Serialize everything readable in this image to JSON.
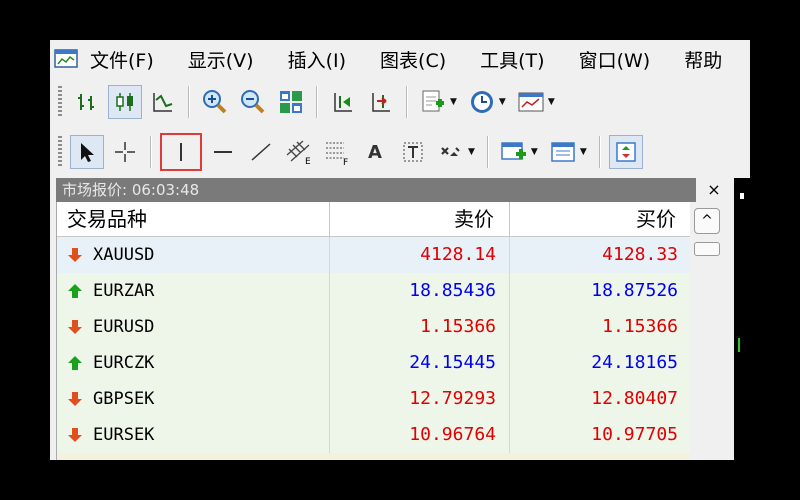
{
  "menu": [
    {
      "label": "文件(F)"
    },
    {
      "label": "显示(V)"
    },
    {
      "label": "插入(I)"
    },
    {
      "label": "图表(C)"
    },
    {
      "label": "工具(T)"
    },
    {
      "label": "窗口(W)"
    },
    {
      "label": "帮助"
    }
  ],
  "toolbar1": {
    "icons": [
      "bar-chart-icon",
      "candlestick-chart-icon",
      "line-chart-icon",
      "zoom-in-icon",
      "zoom-out-icon",
      "tile-windows-icon",
      "chart-shift-icon",
      "auto-scroll-icon",
      "new-chart-icon",
      "clock-period-icon",
      "templates-icon"
    ]
  },
  "toolbar2": {
    "text_tool_label": "A",
    "icons": [
      "cursor-icon",
      "crosshair-icon",
      "vertical-line-icon",
      "horizontal-line-icon",
      "trendline-icon",
      "equidistant-channel-icon",
      "fibonacci-icon",
      "text-icon",
      "text-label-icon",
      "arrows-icon",
      "new-order-icon",
      "indicator-window-icon",
      "expert-icon"
    ]
  },
  "market_watch": {
    "title": "市场报价: 06:03:48",
    "close_label": "×",
    "columns": {
      "symbol": "交易品种",
      "bid": "卖价",
      "ask": "买价"
    },
    "rows": [
      {
        "symbol": "XAUUSD",
        "bid": "4128.14",
        "ask": "4128.33",
        "direction": "down",
        "color": "#e00000",
        "bg": "#e8f0f8"
      },
      {
        "symbol": "EURZAR",
        "bid": "18.85436",
        "ask": "18.87526",
        "direction": "up",
        "color": "#0000ee",
        "bg": "#eef6ea"
      },
      {
        "symbol": "EURUSD",
        "bid": "1.15366",
        "ask": "1.15366",
        "direction": "down",
        "color": "#e00000",
        "bg": "#eef6ea"
      },
      {
        "symbol": "EURCZK",
        "bid": "24.15445",
        "ask": "24.18165",
        "direction": "up",
        "color": "#0000ee",
        "bg": "#eef6ea"
      },
      {
        "symbol": "GBPSEK",
        "bid": "12.79293",
        "ask": "12.80407",
        "direction": "down",
        "color": "#e00000",
        "bg": "#eef6ea"
      },
      {
        "symbol": "EURSEK",
        "bid": "10.96764",
        "ask": "10.97705",
        "direction": "down",
        "color": "#e00000",
        "bg": "#eef6ea"
      }
    ],
    "scroll_up_label": "^"
  },
  "colors": {
    "down_arrow": "#e0501e",
    "up_arrow": "#1aa31a"
  }
}
